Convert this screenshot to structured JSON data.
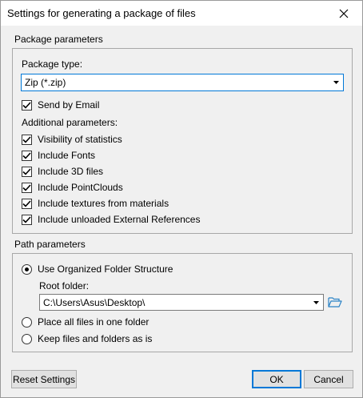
{
  "window": {
    "title": "Settings for generating a package of files"
  },
  "package_section": {
    "title": "Package parameters",
    "type_label": "Package type:",
    "type_value": "Zip (*.zip)",
    "send_by_email": {
      "label": "Send by Email",
      "checked": true
    },
    "additional_label": "Additional parameters:",
    "options": [
      {
        "label": "Visibility of statistics",
        "checked": true
      },
      {
        "label": "Include Fonts",
        "checked": true
      },
      {
        "label": "Include 3D files",
        "checked": true
      },
      {
        "label": "Include PointClouds",
        "checked": true
      },
      {
        "label": "Include textures from materials",
        "checked": true
      },
      {
        "label": "Include unloaded External References",
        "checked": true
      }
    ]
  },
  "path_section": {
    "title": "Path parameters",
    "radios": [
      {
        "label": "Use Organized Folder Structure",
        "selected": true
      },
      {
        "label": "Place all files in one folder",
        "selected": false
      },
      {
        "label": "Keep files and folders as is",
        "selected": false
      }
    ],
    "root_folder_label": "Root folder:",
    "root_folder_value": "C:\\Users\\Asus\\Desktop\\"
  },
  "buttons": {
    "reset": "Reset Settings",
    "ok": "OK",
    "cancel": "Cancel"
  },
  "colors": {
    "accent": "#0078d7",
    "folder_icon": "#2b83c6"
  }
}
